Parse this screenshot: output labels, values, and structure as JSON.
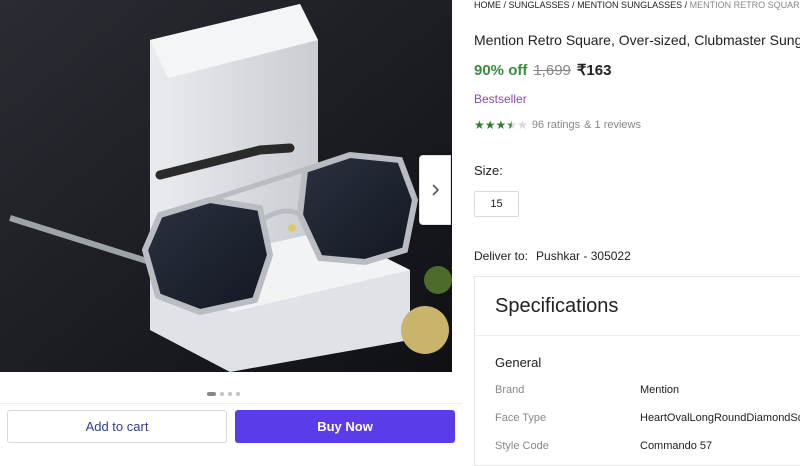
{
  "breadcrumb": {
    "items": [
      "HOME",
      "SUNGLASSES",
      "MENTION SUNGLASSES"
    ],
    "current": "MENTION RETRO SQUARE, OVER-S",
    "separator": " / "
  },
  "product": {
    "title": "Mention Retro Square, Over-sized, Clubmaster Sungla",
    "discount": "90% off",
    "mrp": "1,699",
    "price": "₹163",
    "badge": "Bestseller",
    "rating_value": 3.5,
    "ratings_text": "96 ratings",
    "reviews_text": "& 1 reviews"
  },
  "size": {
    "label": "Size:",
    "selected": "15"
  },
  "delivery": {
    "label": "Deliver to:",
    "location": "Pushkar - 305022"
  },
  "gallery": {
    "dots_total": 4,
    "active_index": 0,
    "next_icon": "chevron-right-icon"
  },
  "actions": {
    "add_to_cart": "Add to cart",
    "buy_now": "Buy Now"
  },
  "specifications": {
    "title": "Specifications",
    "group": "General",
    "rows": [
      {
        "key": "Brand",
        "value": "Mention"
      },
      {
        "key": "Face Type",
        "value": "HeartOvalLongRoundDiamondSq"
      },
      {
        "key": "Style Code",
        "value": "Commando 57"
      }
    ]
  },
  "colors": {
    "discount_green": "#388e3c",
    "rating_green": "#2e7d32",
    "buy_now_bg": "#5b3ce8",
    "add_to_cart_text": "#2f3b94",
    "bestseller_purple": "#8a4aa8"
  }
}
